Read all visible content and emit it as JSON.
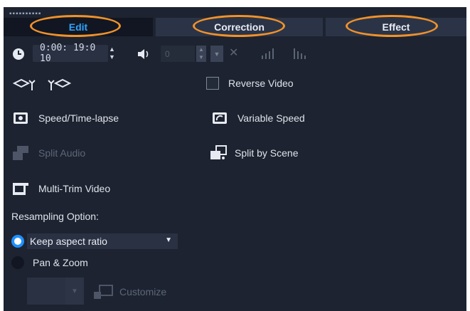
{
  "tabs": [
    {
      "label": "Edit",
      "active": true
    },
    {
      "label": "Correction",
      "active": false
    },
    {
      "label": "Effect",
      "active": false
    }
  ],
  "duration": {
    "timecode": "0:00: 19:0 10",
    "icon": "clock-icon"
  },
  "volume": {
    "value": "0",
    "icon": "speaker-icon"
  },
  "rotate": {
    "left_icon": "rotate-left-icon",
    "right_icon": "rotate-right-icon"
  },
  "reverse_video": {
    "label": "Reverse Video",
    "checked": false
  },
  "speed_timelapse": {
    "label": "Speed/Time-lapse",
    "icon": "speed-icon"
  },
  "variable_speed": {
    "label": "Variable Speed",
    "icon": "variable-speed-icon"
  },
  "split_audio": {
    "label": "Split Audio",
    "icon": "split-audio-icon",
    "enabled": false
  },
  "split_by_scene": {
    "label": "Split by Scene",
    "icon": "split-scene-icon"
  },
  "multi_trim": {
    "label": "Multi-Trim Video",
    "icon": "multi-trim-icon"
  },
  "resampling": {
    "heading": "Resampling Option:",
    "keep_aspect": {
      "label": "Keep aspect ratio",
      "selected": true
    },
    "pan_zoom": {
      "label": "Pan & Zoom",
      "selected": false
    }
  },
  "customize": {
    "label": "Customize",
    "enabled": false
  },
  "colors": {
    "panel": "#1d2330",
    "active_tab_text": "#2fa3ff",
    "highlight_ring": "#f0922b",
    "radio_selected": "#1e90ff"
  }
}
